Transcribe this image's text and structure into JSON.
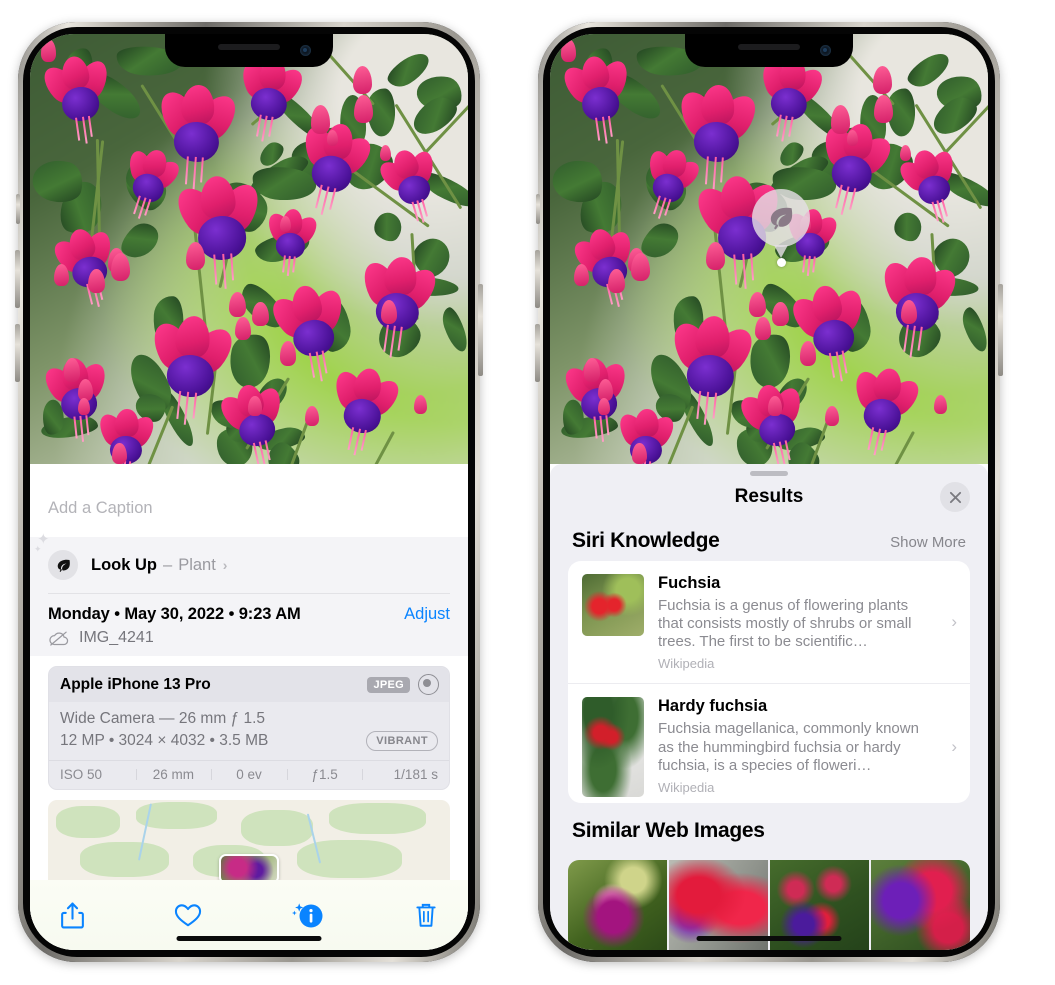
{
  "left_phone": {
    "caption_placeholder": "Add a Caption",
    "lookup": {
      "icon": "leaf-icon",
      "label": "Look Up",
      "dash": "–",
      "subject": "Plant",
      "chevron": "›"
    },
    "meta": {
      "date": "Monday • May 30, 2022 • 9:23 AM",
      "adjust_label": "Adjust",
      "filename": "IMG_4241",
      "cloud_icon": "cloud-off-icon"
    },
    "camera_card": {
      "model": "Apple iPhone 13 Pro",
      "format_tag": "JPEG",
      "aperture_icon": "aperture-icon",
      "lens": "Wide Camera — 26 mm ƒ 1.5",
      "specs": "12 MP • 3024 × 4032 • 3.5 MB",
      "style_tag": "VIBRANT",
      "exif": [
        "ISO 50",
        "26 mm",
        "0 ev",
        "ƒ1.5",
        "1/181 s"
      ]
    },
    "toolbar": [
      {
        "name": "share-button",
        "icon": "share-icon"
      },
      {
        "name": "favorite-button",
        "icon": "heart-icon"
      },
      {
        "name": "info-button",
        "icon": "info-sparkle-icon"
      },
      {
        "name": "delete-button",
        "icon": "trash-icon"
      }
    ]
  },
  "right_phone": {
    "badge": {
      "icon": "leaf-icon"
    },
    "sheet": {
      "title": "Results",
      "close_icon": "close-icon",
      "grabber": "drag-handle"
    },
    "siri_knowledge": {
      "title": "Siri Knowledge",
      "show_more": "Show More",
      "items": [
        {
          "title": "Fuchsia",
          "description": "Fuchsia is a genus of flowering plants that consists mostly of shrubs or small trees. The first to be scientific…",
          "source": "Wikipedia",
          "chevron": "›"
        },
        {
          "title": "Hardy fuchsia",
          "description": "Fuchsia magellanica, commonly known as the hummingbird fuchsia or hardy fuchsia, is a species of floweri…",
          "source": "Wikipedia",
          "chevron": "›"
        }
      ]
    },
    "similar_web_images": {
      "title": "Similar Web Images",
      "count": 4
    }
  },
  "colors": {
    "accent_blue": "#0a84ff",
    "sheet_bg": "#efeff4",
    "card_bg": "#ffffff",
    "secondary_text": "#8b8b91"
  }
}
